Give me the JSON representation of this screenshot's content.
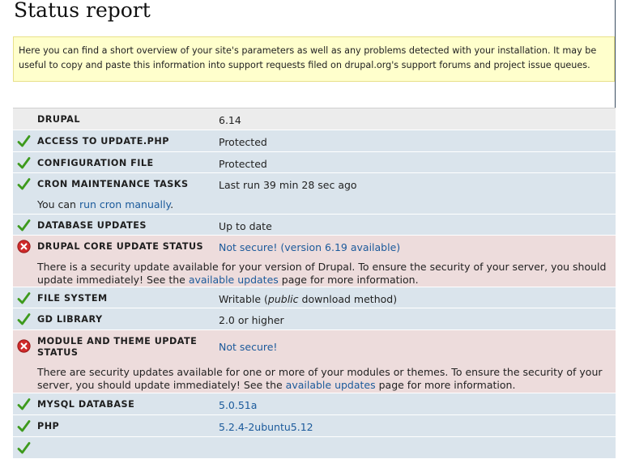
{
  "page": {
    "title": "Status report"
  },
  "intro": "Here you can find a short overview of your site's parameters as well as any problems detected with your installation. It may be useful to copy and paste this information into support requests filed on drupal.org's support forums and project issue queues.",
  "status_icons": {
    "ok": "checkmark-icon",
    "error": "error-icon"
  },
  "colors": {
    "ok_row": "#dae4ec",
    "error_row": "#eddcdc",
    "info_row": "#ececec",
    "link": "#1b5a9b"
  },
  "rows": {
    "drupal": {
      "title": "Drupal",
      "value": "6.14"
    },
    "update_php": {
      "title": "Access to update.php",
      "value": "Protected"
    },
    "config_file": {
      "title": "Configuration file",
      "value": "Protected"
    },
    "cron": {
      "title": "Cron maintenance tasks",
      "value": "Last run 39 min 28 sec ago",
      "desc_before": "You can ",
      "desc_link": "run cron manually",
      "desc_after": "."
    },
    "db_updates": {
      "title": "Database updates",
      "value": "Up to date"
    },
    "core_update": {
      "title": "Drupal core update status",
      "value": "Not secure! (version 6.19 available)",
      "desc_before": "There is a security update available for your version of Drupal. To ensure the security of your server, you should update immediately! See the ",
      "desc_link": "available updates",
      "desc_after": " page for more information."
    },
    "file_system": {
      "title": "File system",
      "value_before": "Writable (",
      "value_em": "public",
      "value_after": " download method)"
    },
    "gd_library": {
      "title": "GD library",
      "value": "2.0 or higher"
    },
    "module_update": {
      "title": "Module and theme update status",
      "value": "Not secure!",
      "desc_before": "There are security updates available for one or more of your modules or themes. To ensure the security of your server, you should update immediately! See the ",
      "desc_link": "available updates",
      "desc_after": " page for more information."
    },
    "mysql": {
      "title": "MySQL database",
      "value": "5.0.51a"
    },
    "php": {
      "title": "PHP",
      "value": "5.2.4-2ubuntu5.12"
    }
  }
}
